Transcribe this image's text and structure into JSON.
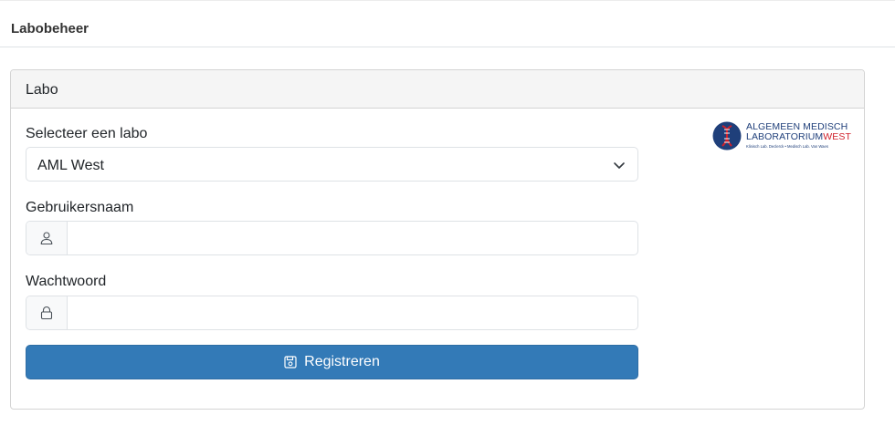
{
  "page": {
    "title": "Labobeheer"
  },
  "card": {
    "header": "Labo"
  },
  "form": {
    "labo_label": "Selecteer een labo",
    "labo_selected": "AML West",
    "username_label": "Gebruikersnaam",
    "username_value": "",
    "password_label": "Wachtwoord",
    "password_value": "",
    "submit_label": "Registreren"
  },
  "logo": {
    "line1": "ALGEMEEN MEDISCH",
    "line2_main": "LABORATORIUM",
    "line2_accent": "WEST",
    "line3": "Klinisch Lab. Declerck • Medisch Lab. Van Waes"
  },
  "colors": {
    "primary": "#337ab7",
    "logo_blue": "#1f3f7a",
    "logo_red": "#d0202a"
  },
  "icons": {
    "user": "user-icon",
    "lock": "lock-icon",
    "save": "save-icon",
    "chevron": "chevron-down-icon"
  }
}
